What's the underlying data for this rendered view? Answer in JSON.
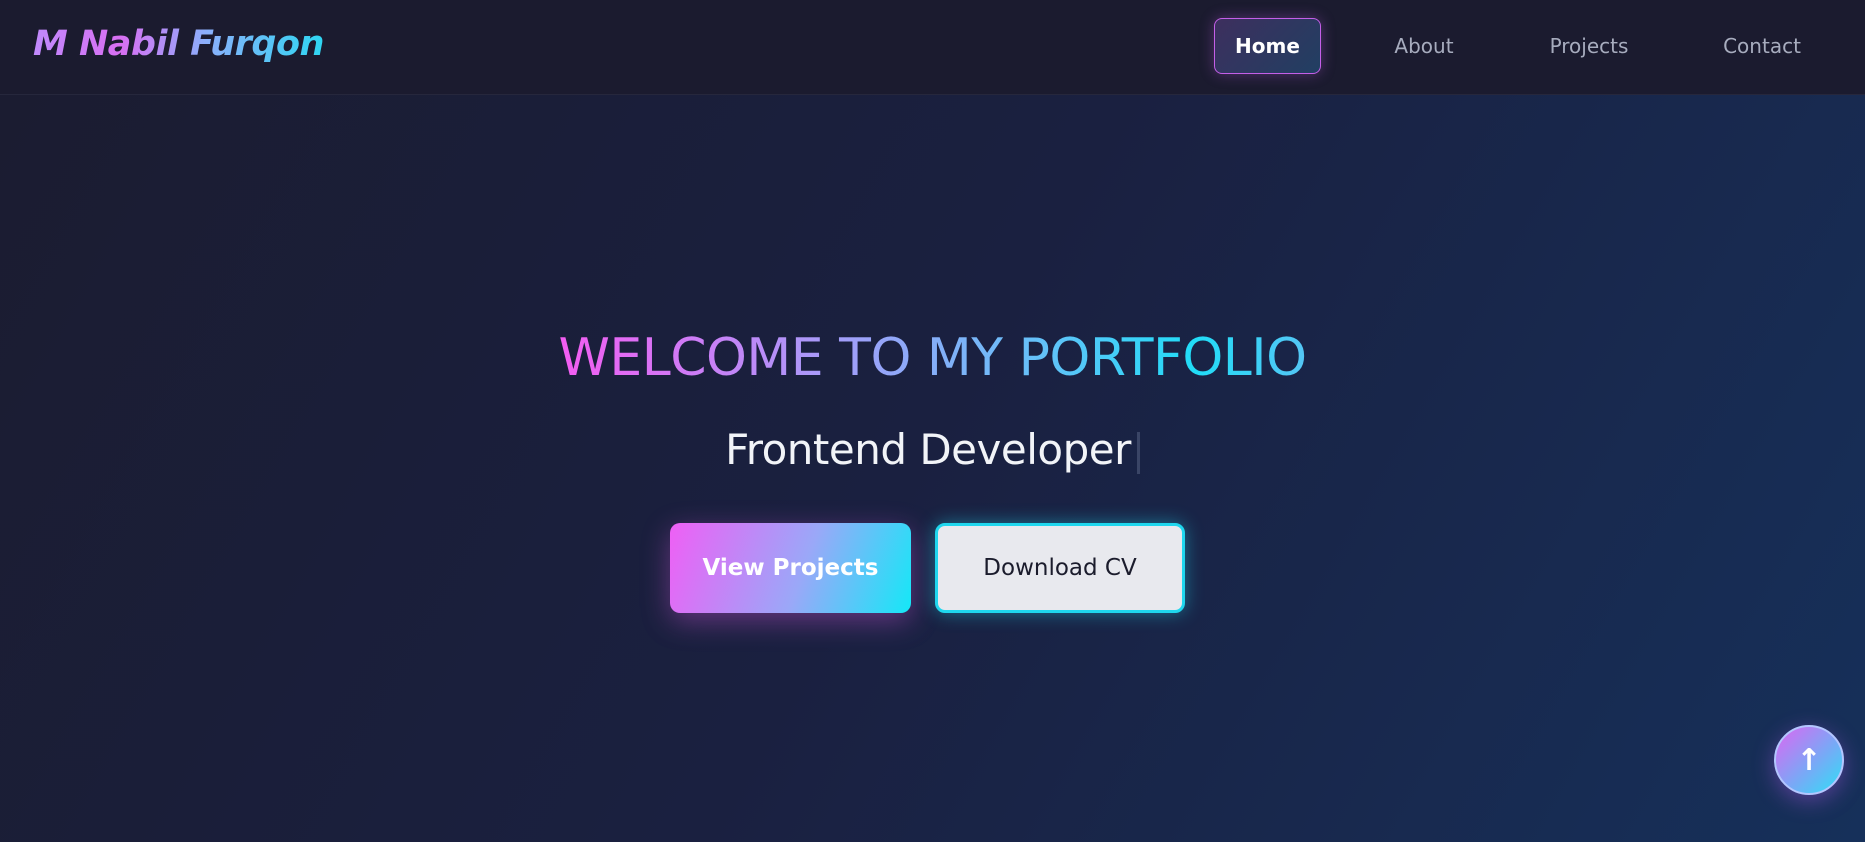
{
  "navbar": {
    "brand": "M Nabil Furqon",
    "links": [
      {
        "label": "Home",
        "active": true
      },
      {
        "label": "About",
        "active": false
      },
      {
        "label": "Projects",
        "active": false
      },
      {
        "label": "Contact",
        "active": false
      }
    ]
  },
  "hero": {
    "title": "WELCOME TO MY PORTFOLIO",
    "role": "Frontend Developer",
    "primary_button": "View Projects",
    "secondary_button": "Download CV"
  },
  "scroll_top": {
    "icon": "arrow-up-icon",
    "glyph": "↑"
  },
  "colors": {
    "accent_pink": "#f45cf2",
    "accent_cyan": "#21dcf7",
    "background": "#1b1c30"
  }
}
